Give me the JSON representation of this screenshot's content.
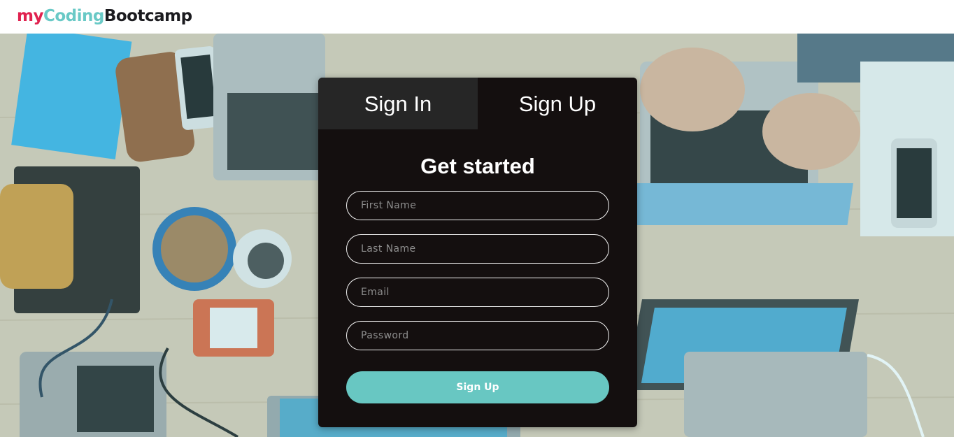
{
  "brand": {
    "part1": "my",
    "part2": "Coding",
    "part3": "Bootcamp"
  },
  "tabs": [
    {
      "label": "Sign In",
      "active": true
    },
    {
      "label": "Sign Up",
      "active": false
    }
  ],
  "form": {
    "heading": "Get started",
    "fields": [
      {
        "placeholder": "First Name",
        "value": ""
      },
      {
        "placeholder": "Last Name",
        "value": ""
      },
      {
        "placeholder": "Email",
        "value": ""
      },
      {
        "placeholder": "Password",
        "value": ""
      }
    ],
    "submit_label": "Sign Up"
  },
  "colors": {
    "brand_red": "#e0224f",
    "brand_teal": "#69c9c6",
    "card_bg": "#140f0f",
    "button": "#68c7c2"
  }
}
